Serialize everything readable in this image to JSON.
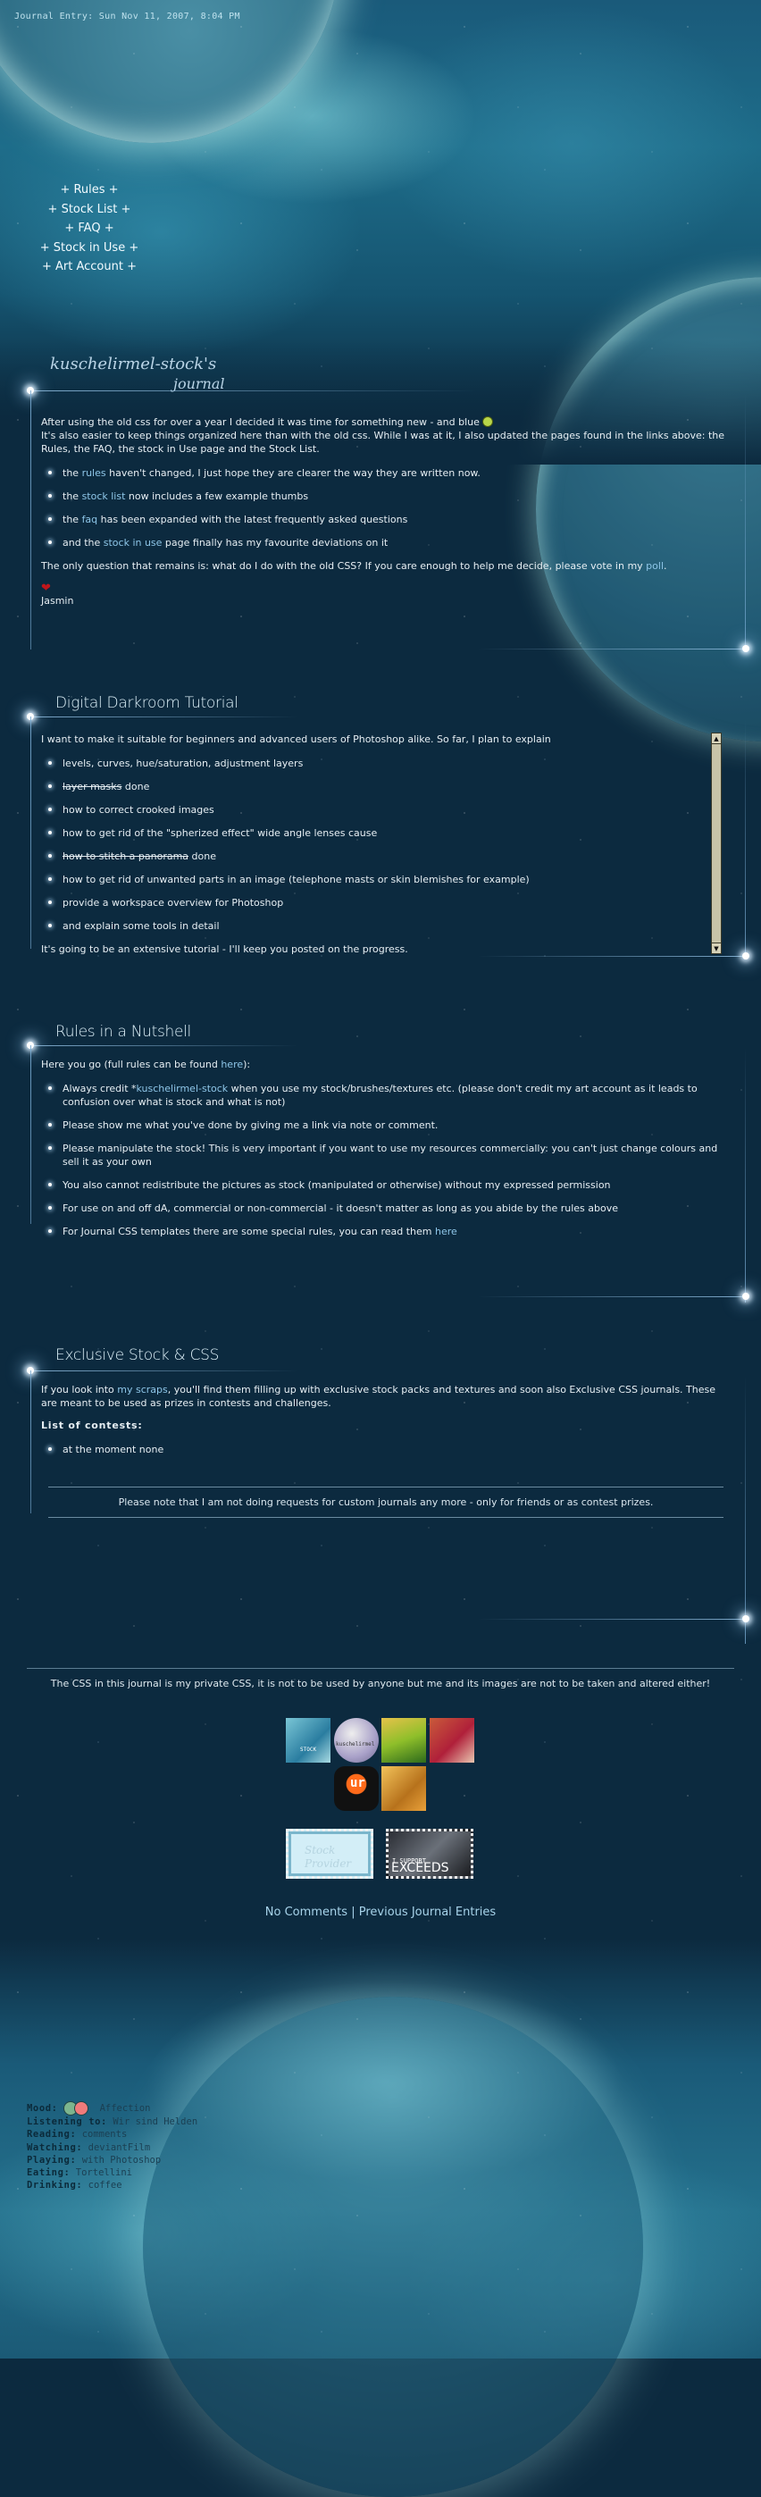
{
  "header": {
    "entry_line": "Journal Entry: Sun Nov 11, 2007, 8:04 PM",
    "nav": [
      "+ Rules +",
      "+ Stock List +",
      "+ FAQ +",
      "+ Stock in Use +",
      "+ Art Account +"
    ]
  },
  "journal": {
    "script_title_1": "kuschelirmel-stock's",
    "script_title_2": "journal",
    "intro_1": "After using the old css for over a year I decided it was time for something new - and blue",
    "intro_2": "It's also easier to keep things organized here than with the old css. While I was at it, I also updated the pages found in the links above: the Rules, the FAQ, the stock in Use page and the Stock List.",
    "bullets": [
      {
        "pre": "the ",
        "link": "rules",
        "post": " haven't changed, I just hope they are clearer the way they are written now."
      },
      {
        "pre": "the ",
        "link": "stock list",
        "post": " now includes a few example thumbs"
      },
      {
        "pre": "the ",
        "link": "faq",
        "post": " has been expanded with the latest frequently asked questions"
      },
      {
        "pre": "and the ",
        "link": "stock in use",
        "post": " page finally has my favourite deviations on it"
      }
    ],
    "closing_pre": "The only question that remains is: what do I do with the old CSS? If you care enough to help me decide, please vote in my ",
    "closing_link": "poll",
    "closing_post": ".",
    "signature": "Jasmin",
    "icons": {
      "smiley": "grin-emoticon",
      "heart": "heart-icon"
    }
  },
  "tutorial": {
    "title": "Digital Darkroom Tutorial",
    "intro": "I want to make it suitable for beginners and advanced users of Photoshop alike. So far, I plan to explain",
    "items": [
      {
        "text": "levels, curves, hue/saturation, adjustment layers",
        "struck": "",
        "suffix": ""
      },
      {
        "text": "",
        "struck": "layer masks",
        "suffix": " done"
      },
      {
        "text": "how to correct crooked images",
        "struck": "",
        "suffix": ""
      },
      {
        "text": "how to get rid of the \"spherized effect\" wide angle lenses cause",
        "struck": "",
        "suffix": ""
      },
      {
        "text": "",
        "struck": "how to stitch a panorama",
        "suffix": " done"
      },
      {
        "text": "how to get rid of unwanted parts in an image (telephone masts or skin blemishes for example)",
        "struck": "",
        "suffix": ""
      },
      {
        "text": "provide a workspace overview for Photoshop",
        "struck": "",
        "suffix": ""
      },
      {
        "text": "and explain some tools in detail",
        "struck": "",
        "suffix": ""
      }
    ],
    "outro": "It's going to be an extensive tutorial - I'll keep you posted on the progress."
  },
  "rules": {
    "title": "Rules in a Nutshell",
    "intro_pre": "Here you go (full rules can be found ",
    "intro_link": "here",
    "intro_post": "):",
    "items": [
      {
        "pre": "Always credit *",
        "link": "kuschelirmel-stock",
        "post": " when you use my stock/brushes/textures etc. (please don't credit my art account as it leads to confusion over what is stock and what is not)"
      },
      {
        "pre": "Please show me what you've done by giving me a link via note or comment.",
        "link": "",
        "post": ""
      },
      {
        "pre": "Please manipulate the stock! This is very important if you want to use my resources commercially: you can't just change colours and sell it as your own",
        "link": "",
        "post": ""
      },
      {
        "pre": "You also cannot redistribute the pictures as stock (manipulated or otherwise) without my expressed permission",
        "link": "",
        "post": ""
      },
      {
        "pre": "For use on and off dA, commercial or non-commercial - it doesn't matter as long as you abide by the rules above",
        "link": "",
        "post": ""
      },
      {
        "pre": "For Journal CSS templates there are some special rules, you can read them ",
        "link": "here",
        "post": ""
      }
    ]
  },
  "exclusive": {
    "title": "Exclusive Stock & CSS",
    "intro_pre": "If you look into ",
    "intro_link": "my scraps",
    "intro_post": ", you'll find them filling up with exclusive stock packs and textures and soon also Exclusive CSS journals. These are meant to be used as prizes in contests and challenges.",
    "contests_heading": "List of contests:",
    "contests": [
      "at the moment none"
    ],
    "note": "Please note that I am not doing requests for custom journals any more - only for friends or as contest prizes."
  },
  "footer": {
    "disclaimer": "The CSS in this journal is my private CSS, it is not to be used by anyone but me and its images are not to be taken and altered either!",
    "thumb_labels": [
      "STOCK",
      "kuschelirmel",
      "",
      "",
      "ur",
      ""
    ],
    "stamp1": "Stock Provider",
    "stamp2_small": "I SUPPORT",
    "stamp2_big": "EXCEEDS",
    "links": {
      "comments": "No Comments",
      "separator": "|",
      "previous": "Previous Journal Entries"
    }
  },
  "moods": [
    {
      "label": "Mood:",
      "value": "Affection"
    },
    {
      "label": "Listening to:",
      "value": "Wir sind Helden"
    },
    {
      "label": "Reading:",
      "value": "comments"
    },
    {
      "label": "Watching:",
      "value": "deviantFilm"
    },
    {
      "label": "Playing:",
      "value": "with Photoshop"
    },
    {
      "label": "Eating:",
      "value": "Tortellini"
    },
    {
      "label": "Drinking:",
      "value": "coffee"
    }
  ]
}
